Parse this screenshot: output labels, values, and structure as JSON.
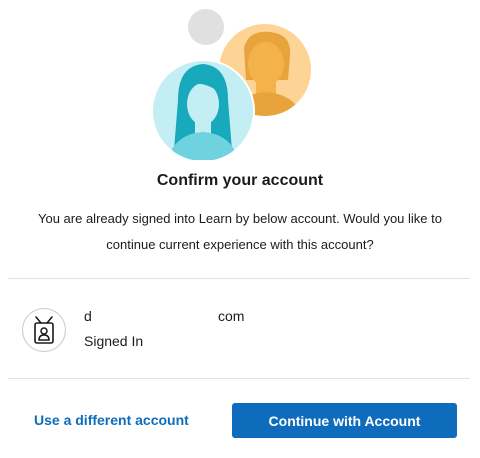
{
  "illustration": {
    "icon": "confirm-account-illustration"
  },
  "dialog": {
    "title": "Confirm your account",
    "message_line1": "You are already signed into Learn by below account. Would you like to",
    "message_line2": "continue current experience with this account?"
  },
  "account": {
    "icon": "id-badge-icon",
    "name": "d",
    "domain": "com",
    "status": "Signed In"
  },
  "actions": {
    "use_different": "Use a different account",
    "continue": "Continue with Account"
  },
  "colors": {
    "accent": "#0f6cbd",
    "orange_circle": "#fdd495",
    "teal_circle": "#3fc8d8",
    "gray_circle": "#e0e0e0"
  }
}
